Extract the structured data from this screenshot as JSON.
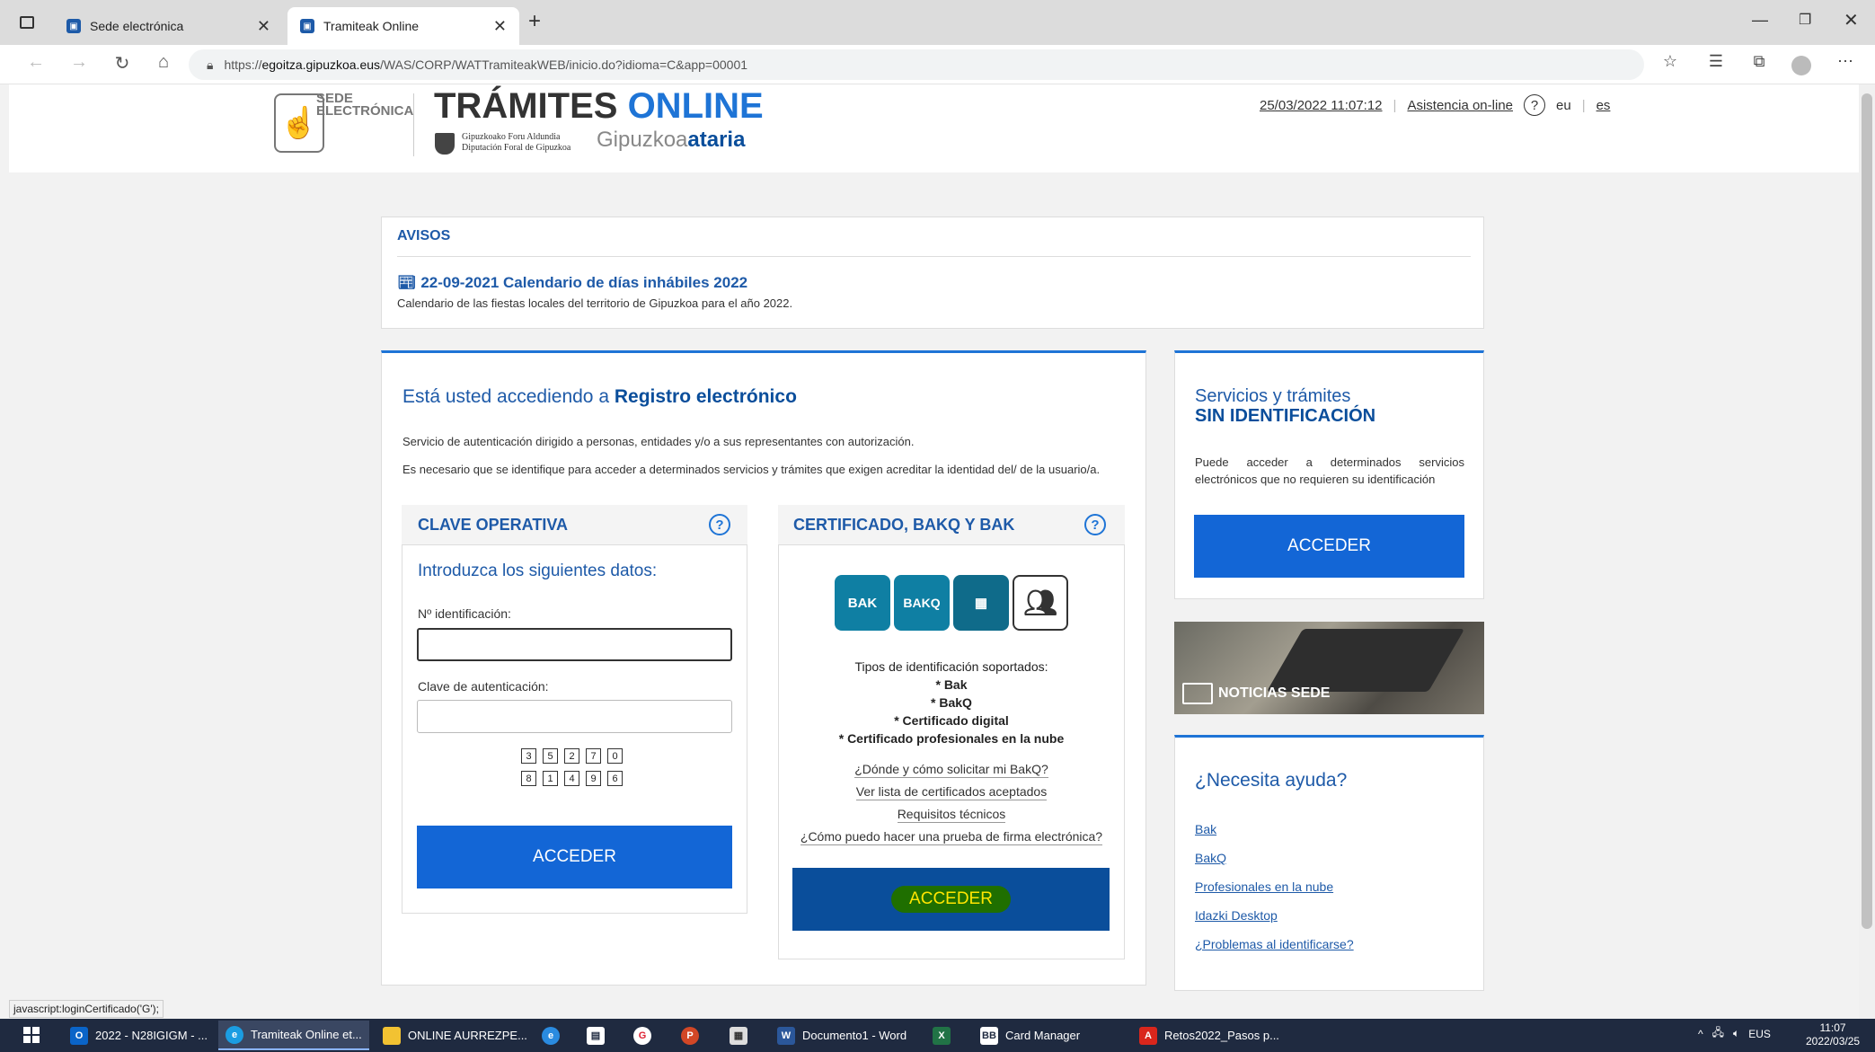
{
  "browser": {
    "tabs": [
      {
        "title": "Sede electrónica",
        "active": false
      },
      {
        "title": "Tramiteak Online",
        "active": true
      }
    ],
    "url_prefix": "https://",
    "url_domain": "egoitza.gipuzkoa.eus",
    "url_path": "/WAS/CORP/WATTramiteakWEB/inicio.do?idioma=C&app=00001",
    "status_text": "javascript:loginCertificado('G');"
  },
  "header": {
    "sede_line1": "SEDE",
    "sede_line2": "ELECTRÓNICA",
    "title_main": "TRÁMITES",
    "title_accent": "ONLINE",
    "gfa_line1": "Gipuzkoako Foru Aldundia",
    "gfa_line2": "Diputación Foral de Gipuzkoa",
    "gatari_light": "Gipuzkoa",
    "gatari_bold": "ataria",
    "datetime": "25/03/2022 11:07:12",
    "assist": "Asistencia on-line",
    "help": "?",
    "lang_eu": "eu",
    "lang_es": "es"
  },
  "avisos": {
    "title": "AVISOS",
    "link": "22-09-2021 Calendario de días inhábiles 2022",
    "desc": "Calendario de las fiestas locales del territorio de Gipuzkoa para el año 2022."
  },
  "main": {
    "title_pre": "Está usted accediendo a ",
    "title_bold": "Registro electrónico",
    "p1": "Servicio de autenticación dirigido a personas, entidades y/o a sus representantes con autorización.",
    "p2": "Es necesario que se identifique para acceder a determinados servicios y trámites que exigen acreditar la identidad del/ de la usuario/a."
  },
  "clave": {
    "title": "CLAVE OPERATIVA",
    "help": "?",
    "intro": "Introduzca los siguientes datos:",
    "id_label": "Nº identificación:",
    "id_value": "",
    "pass_label": "Clave de autenticación:",
    "pass_value": "",
    "pin_row1": [
      "3",
      "5",
      "2",
      "7",
      "0"
    ],
    "pin_row2": [
      "8",
      "1",
      "4",
      "9",
      "6"
    ],
    "button": "ACCEDER"
  },
  "cert": {
    "title": "CERTIFICADO, BAKQ Y BAK",
    "help": "?",
    "badges": [
      "BAK",
      "BAKQ"
    ],
    "tipos_title": "Tipos de identificación soportados:",
    "tipos": [
      "* Bak",
      "* BakQ",
      "* Certificado digital",
      "* Certificado profesionales en la nube"
    ],
    "links": [
      "¿Dónde y cómo solicitar mi BakQ?",
      "Ver lista de certificados aceptados",
      "Requisitos técnicos",
      "¿Cómo puedo hacer una prueba de firma electrónica?"
    ],
    "button": "ACCEDER"
  },
  "sin_id": {
    "line1": "Servicios y trámites",
    "line2": "SIN IDENTIFICACIÓN",
    "desc": "Puede acceder a determinados servicios electrónicos que no requieren su identificación",
    "button": "ACCEDER"
  },
  "news": {
    "label": "NOTICIAS SEDE"
  },
  "help": {
    "title": "¿Necesita ayuda?",
    "links": [
      "Bak",
      "BakQ",
      "Profesionales en la nube",
      "Idazki Desktop",
      "¿Problemas al identificarse?"
    ]
  },
  "taskbar": {
    "items": [
      "2022 - N28IGIGM - ...",
      "Tramiteak Online et...",
      "ONLINE AURREZPE...",
      "Documento1 - Word",
      "Card Manager",
      "Retos2022_Pasos p..."
    ],
    "lang": "EUS",
    "time": "11:07",
    "date": "2022/03/25"
  },
  "colors": {
    "accent": "#1e74d6",
    "brand_dark": "#0a4e9b",
    "button": "#1366d6",
    "bak_teal": "#0f7fa3"
  }
}
